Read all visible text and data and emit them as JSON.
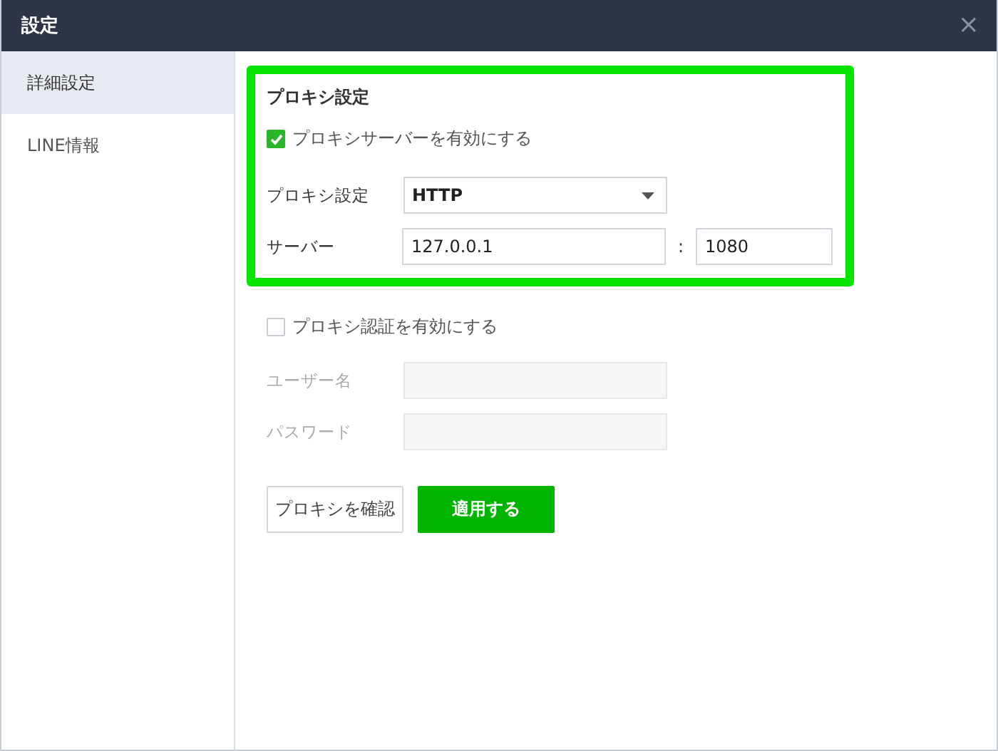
{
  "window": {
    "title": "設定",
    "close": "×"
  },
  "sidebar": {
    "items": [
      {
        "label": "詳細設定",
        "selected": true
      },
      {
        "label": "LINE情報",
        "selected": false
      }
    ]
  },
  "proxy": {
    "heading": "プロキシ設定",
    "highlighted": true,
    "enable": {
      "label": "プロキシサーバーを有効にする",
      "checked": true
    },
    "type": {
      "label": "プロキシ設定",
      "value": "HTTP"
    },
    "server": {
      "label": "サーバー",
      "host": "127.0.0.1",
      "separator": ":",
      "port": "1080"
    }
  },
  "auth": {
    "enable": {
      "label": "プロキシ認証を有効にする",
      "checked": false
    },
    "fields": [
      {
        "label": "ユーザー名",
        "disabled": true
      },
      {
        "label": "パスワード",
        "disabled": true
      }
    ]
  },
  "buttons": [
    {
      "label": "プロキシを確認",
      "kind": "secondary"
    },
    {
      "label": "適用する",
      "kind": "primary"
    }
  ]
}
